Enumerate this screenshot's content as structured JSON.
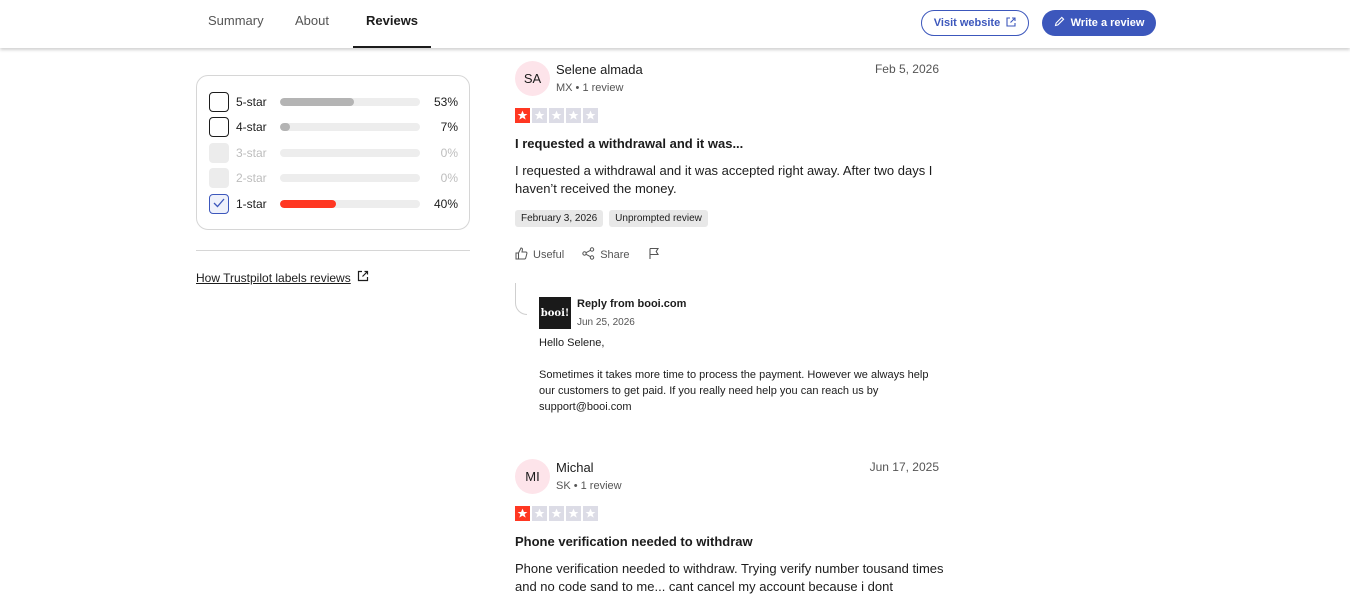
{
  "nav": {
    "tabs": [
      {
        "label": "Summary"
      },
      {
        "label": "About"
      },
      {
        "label": "Reviews"
      }
    ],
    "visit_label": "Visit website",
    "write_label": "Write a review"
  },
  "filters": {
    "rows": [
      {
        "label": "5-star",
        "percent": "53%",
        "fill": 0.53,
        "state": "unchecked"
      },
      {
        "label": "4-star",
        "percent": "7%",
        "fill": 0.07,
        "state": "unchecked"
      },
      {
        "label": "3-star",
        "percent": "0%",
        "fill": 0.0,
        "state": "disabled"
      },
      {
        "label": "2-star",
        "percent": "0%",
        "fill": 0.0,
        "state": "disabled"
      },
      {
        "label": "1-star",
        "percent": "40%",
        "fill": 0.4,
        "state": "checked"
      }
    ],
    "labels_link": "How Trustpilot labels reviews"
  },
  "reviews": [
    {
      "initials": "SA",
      "name": "Selene almada",
      "meta": "MX • 1 review",
      "date": "Feb 5, 2026",
      "rating": 1,
      "title": "I requested a withdrawal and it was...",
      "body": "I requested a withdrawal and it was accepted right away. After two days I haven’t received the money.",
      "experience_date": "February 3, 2026",
      "tag": "Unprompted review",
      "useful_label": "Useful",
      "share_label": "Share",
      "reply": {
        "logo_text": "booi!",
        "from": "Reply from booi.com",
        "date": "Jun 25, 2026",
        "greeting": "Hello Selene,",
        "body": "Sometimes it takes more time to process the payment. However we always help our customers to get paid. If you really need help you can reach us by support@booi.com"
      }
    },
    {
      "initials": "MI",
      "name": "Michal",
      "meta": "SK • 1 review",
      "date": "Jun 17, 2025",
      "rating": 1,
      "title": "Phone verification needed to withdraw",
      "body": "Phone verification needed to withdraw. Trying verify number tousand times and no code sand to me... cant cancel my account because i dont"
    }
  ],
  "colors": {
    "accent": "#3c57bc",
    "star_on": "#ff3722",
    "star_off": "#dcdce6",
    "bar_red": "#ff3722",
    "bar_grey": "#b4b4b4"
  }
}
